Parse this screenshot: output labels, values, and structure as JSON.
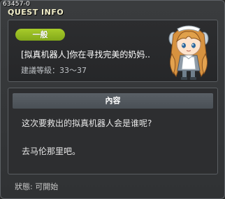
{
  "quest_id": "63457-0",
  "window_title": "QUEST INFO",
  "quest": {
    "category": "一般",
    "name": "[拟真机器人]你在寻找完美的奶妈..",
    "level_range": "建議等級：33～37",
    "npc_icon": "maid-android-npc-portrait"
  },
  "content": {
    "header": "內容",
    "lines": [
      "这次要救出的拟真机器人会是谁呢?",
      "去马伦那里吧。"
    ]
  },
  "status_text": "狀態:  可開始",
  "colors": {
    "badge_green": "#9bc322",
    "title_text": "#f3efc9",
    "panel_border": "#5a5e62"
  }
}
